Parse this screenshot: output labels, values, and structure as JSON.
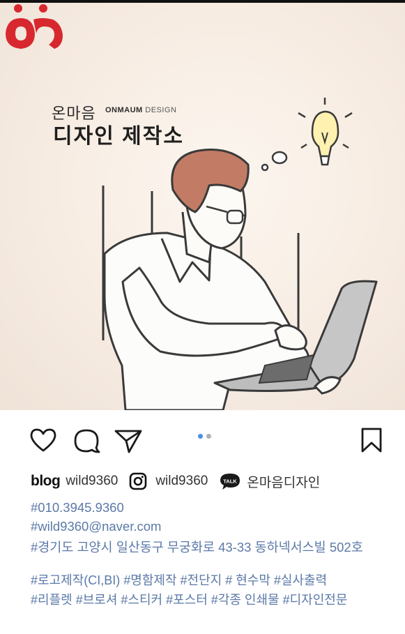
{
  "logo": {
    "small_text": "온마음",
    "brand_bold": "ONMAUM",
    "brand_light": "DESIGN",
    "big_text": "디자인 제작소"
  },
  "colors": {
    "accent_red": "#d8282f",
    "link_blue": "#5b79a8",
    "dot_active": "#4a90e2"
  },
  "actions": {
    "icons": [
      "heart-icon",
      "comment-icon",
      "send-icon",
      "bookmark-icon"
    ],
    "carousel_total": 2,
    "carousel_active": 1
  },
  "contacts": {
    "blog_label": "blog",
    "blog_id": "wild9360",
    "instagram_id": "wild9360",
    "kakao_badge": "TALK",
    "kakao_id": "온마음디자인"
  },
  "info": {
    "phone": "#010.3945.9360",
    "email": "#wild9360@naver.com",
    "address": "#경기도 고양시 일산동구 무궁화로 43-33 동하넥서스빌 502호"
  },
  "tags": {
    "line1": "#로고제작(CI,BI) #명함제작 #전단지 # 현수막 #실사출력",
    "line2": "#리플렛 #브로셔 #스티커 #포스터 #각종 인쇄물 #디자인전문"
  }
}
